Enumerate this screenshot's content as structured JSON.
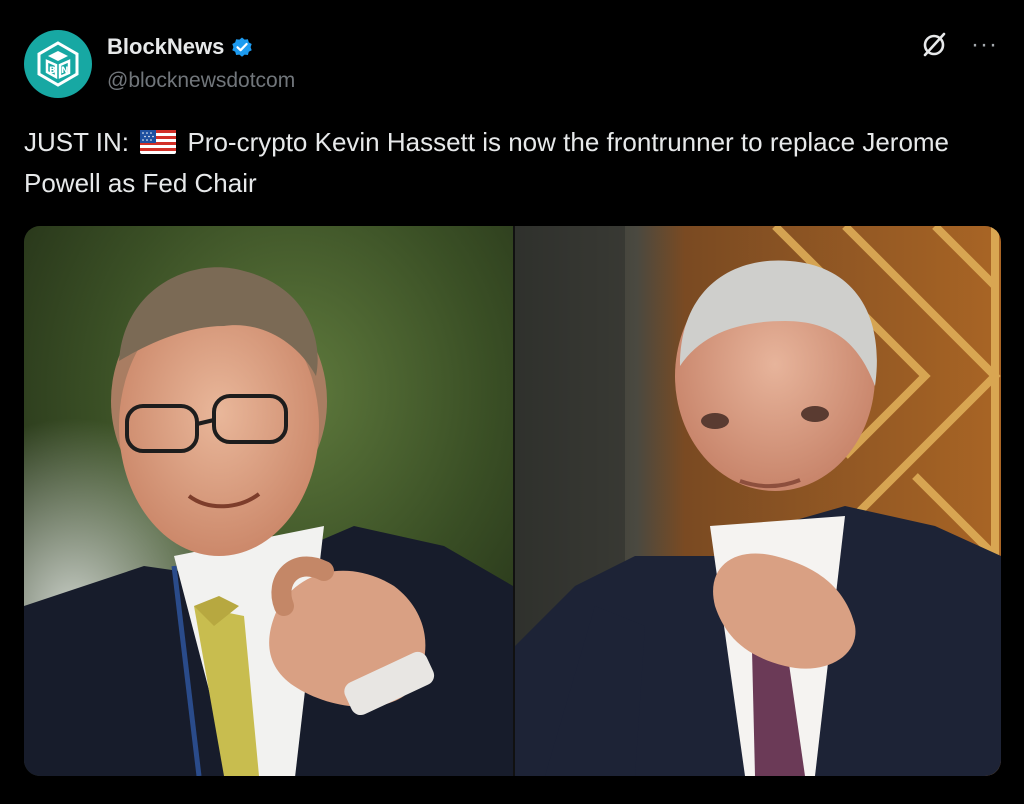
{
  "post": {
    "display_name": "BlockNews",
    "handle": "@blocknewsdotcom",
    "text_prefix": "JUST IN:",
    "text_body": "Pro-crypto Kevin Hassett is now the frontrunner to replace Jerome Powell as Fed Chair",
    "more_label": "···"
  },
  "colors": {
    "avatar_bg": "#17a8a3",
    "verified": "#1d9bf0",
    "handle": "#71767b"
  },
  "icons": {
    "avatar": "blocknews-logo-icon",
    "verified": "verified-badge-icon",
    "grok": "grok-icon",
    "more": "more-icon",
    "flag": "us-flag-icon"
  }
}
